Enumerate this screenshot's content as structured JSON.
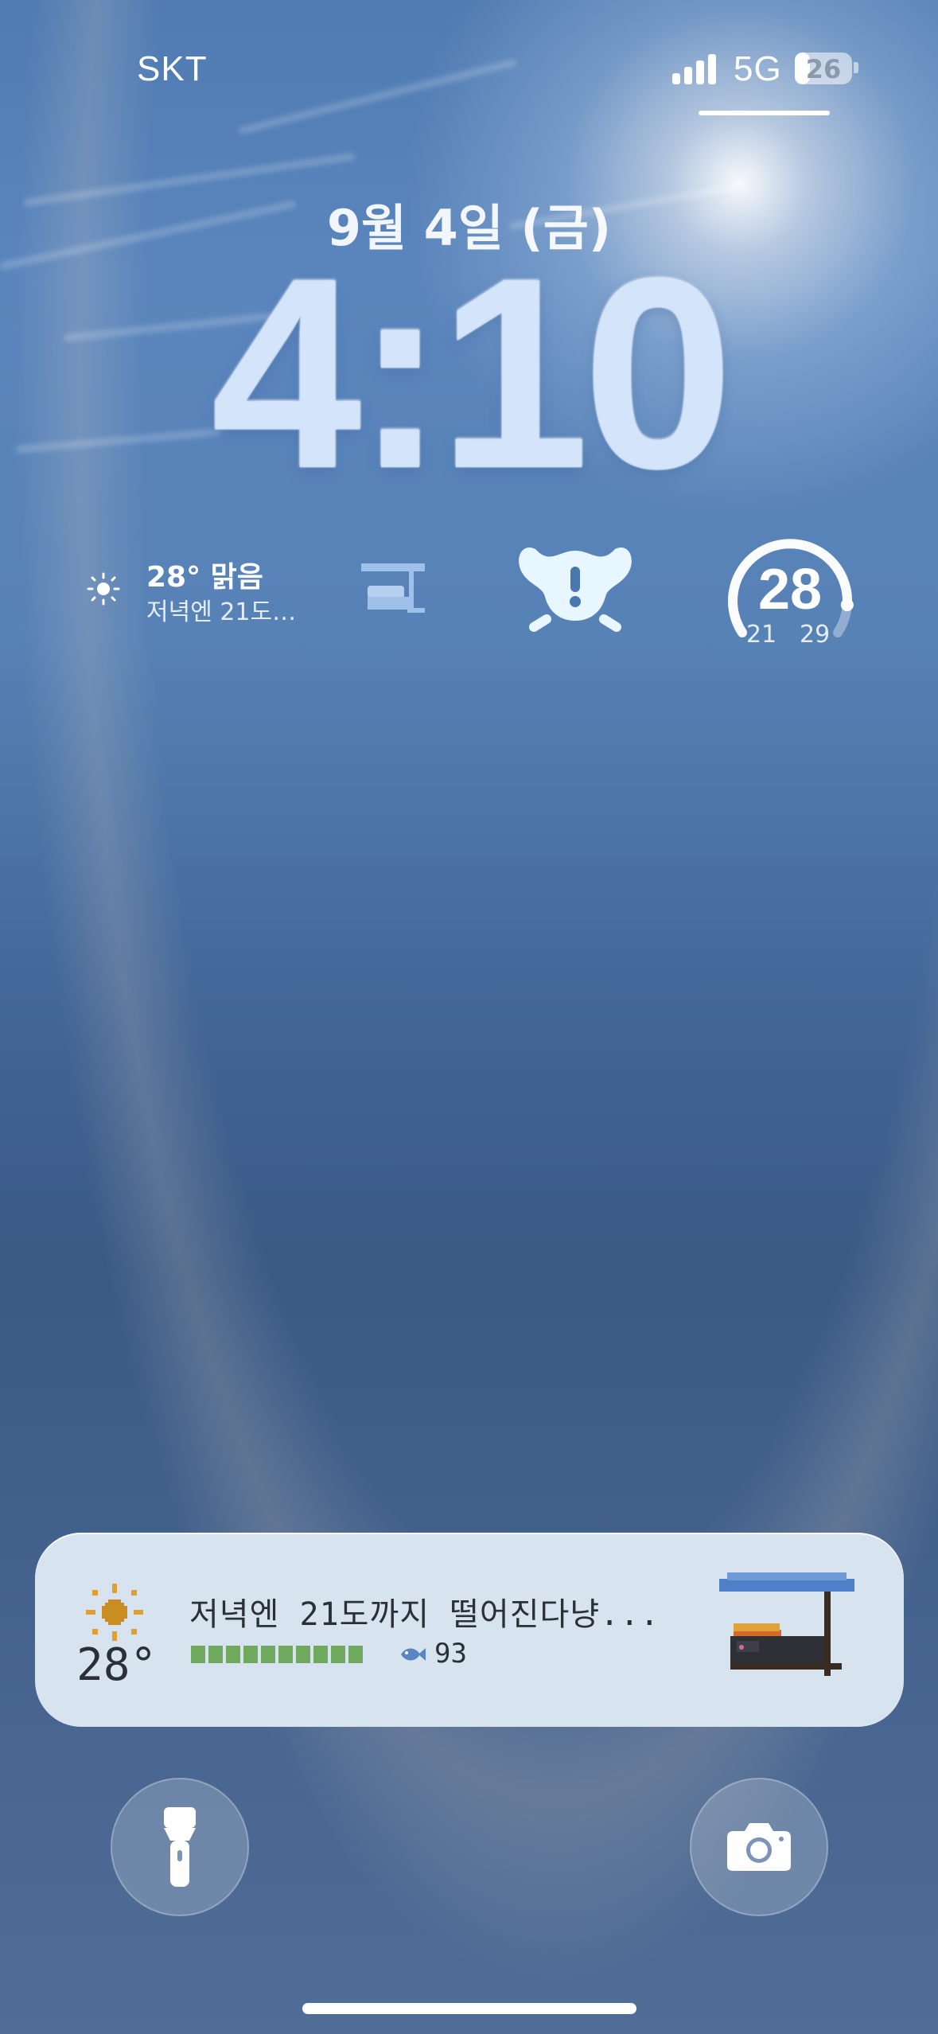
{
  "status_bar": {
    "carrier": "SKT",
    "network": "5G",
    "battery": "26",
    "battery_percent": 26
  },
  "lock_screen": {
    "date": "9월 4일 (금)",
    "time": "4:10"
  },
  "widgets": {
    "weather": {
      "temp": "28° 맑음",
      "desc": "저녁엔 21도…",
      "icon": "sun-icon"
    },
    "cat_icon": "cat-shelter-icon",
    "alert_icon": "alert-creature-icon",
    "gauge": {
      "current": "28",
      "low": "21",
      "high": "29",
      "level_fraction": 0.88
    }
  },
  "live_activity": {
    "temp": "28°",
    "message": "저녁엔 21도까지 떨어진다냥...",
    "fish_count": "93",
    "progress_segments": 10,
    "icon": "sun-icon",
    "cat_icon": "cat-shelter-icon",
    "bar_color": "#6faa5e"
  },
  "quick_actions": {
    "flashlight_icon": "flashlight-icon",
    "camera_icon": "camera-icon"
  }
}
